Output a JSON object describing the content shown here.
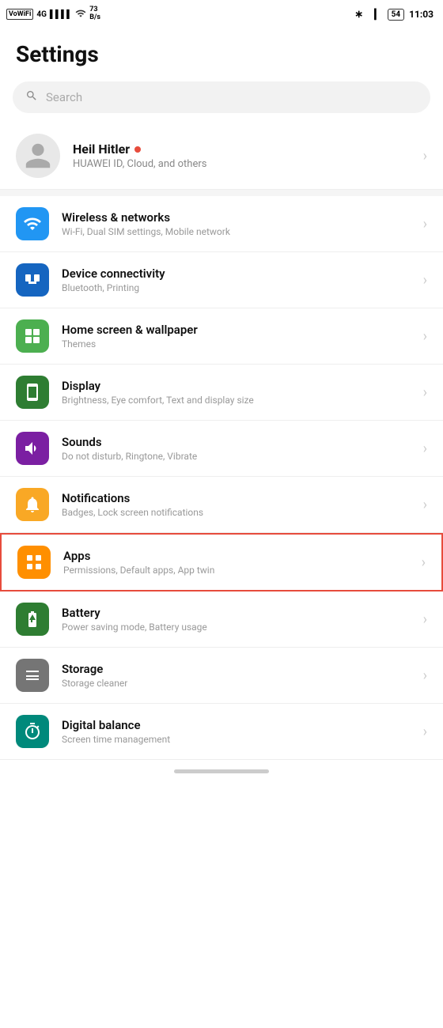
{
  "statusBar": {
    "left": {
      "vowifi": "VoWiFi",
      "signal": "4G",
      "bars": "|||",
      "wifi": "WiFi",
      "speed": "73\nB/s"
    },
    "right": {
      "bluetooth": "BT",
      "battery": "54",
      "time": "11:03"
    }
  },
  "header": {
    "title": "Settings"
  },
  "search": {
    "placeholder": "Search"
  },
  "profile": {
    "name": "Heil Hitler",
    "sub": "HUAWEI ID, Cloud, and others"
  },
  "settingsItems": [
    {
      "id": "wireless",
      "title": "Wireless & networks",
      "sub": "Wi-Fi, Dual SIM settings, Mobile network",
      "iconColor": "icon-blue",
      "highlighted": false
    },
    {
      "id": "device-connectivity",
      "title": "Device connectivity",
      "sub": "Bluetooth, Printing",
      "iconColor": "icon-blue2",
      "highlighted": false
    },
    {
      "id": "home-screen",
      "title": "Home screen & wallpaper",
      "sub": "Themes",
      "iconColor": "icon-green2",
      "highlighted": false
    },
    {
      "id": "display",
      "title": "Display",
      "sub": "Brightness, Eye comfort, Text and display size",
      "iconColor": "icon-green3",
      "highlighted": false
    },
    {
      "id": "sounds",
      "title": "Sounds",
      "sub": "Do not disturb, Ringtone, Vibrate",
      "iconColor": "icon-purple",
      "highlighted": false
    },
    {
      "id": "notifications",
      "title": "Notifications",
      "sub": "Badges, Lock screen notifications",
      "iconColor": "icon-yellow",
      "highlighted": false
    },
    {
      "id": "apps",
      "title": "Apps",
      "sub": "Permissions, Default apps, App twin",
      "iconColor": "icon-orange",
      "highlighted": true
    },
    {
      "id": "battery",
      "title": "Battery",
      "sub": "Power saving mode, Battery usage",
      "iconColor": "icon-green3",
      "highlighted": false
    },
    {
      "id": "storage",
      "title": "Storage",
      "sub": "Storage cleaner",
      "iconColor": "icon-gray",
      "highlighted": false
    },
    {
      "id": "digital-balance",
      "title": "Digital balance",
      "sub": "Screen time management",
      "iconColor": "icon-teal",
      "highlighted": false
    }
  ]
}
